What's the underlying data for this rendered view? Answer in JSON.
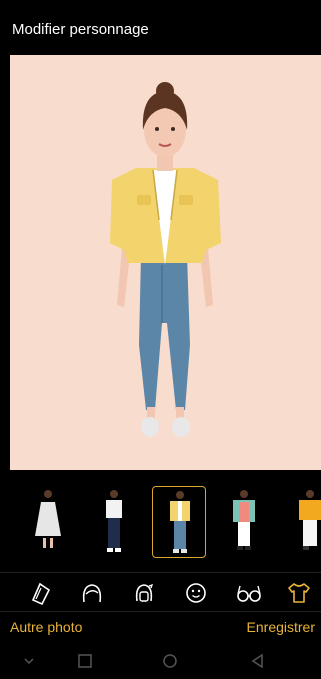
{
  "header": {
    "title": "Modifier personnage"
  },
  "outfits": [
    {
      "icon": "white-lace-dress-outfit"
    },
    {
      "icon": "white-tee-dark-jeans-outfit"
    },
    {
      "icon": "yellow-jacket-jeans-outfit",
      "selected": true
    },
    {
      "icon": "teal-cardigan-pink-top-outfit"
    },
    {
      "icon": "orange-top-white-pants-outfit"
    }
  ],
  "tabs": [
    {
      "icon": "body-shape-icon"
    },
    {
      "icon": "hairstyle-icon"
    },
    {
      "icon": "face-swap-icon"
    },
    {
      "icon": "face-features-icon"
    },
    {
      "icon": "glasses-icon"
    },
    {
      "icon": "tshirt-icon",
      "active": true
    }
  ],
  "actions": {
    "other_photo": "Autre photo",
    "save": "Enregistrer"
  },
  "colors": {
    "accent": "#e9b23a",
    "preview_bg": "#f8dccd",
    "header_bg": "#000000"
  }
}
